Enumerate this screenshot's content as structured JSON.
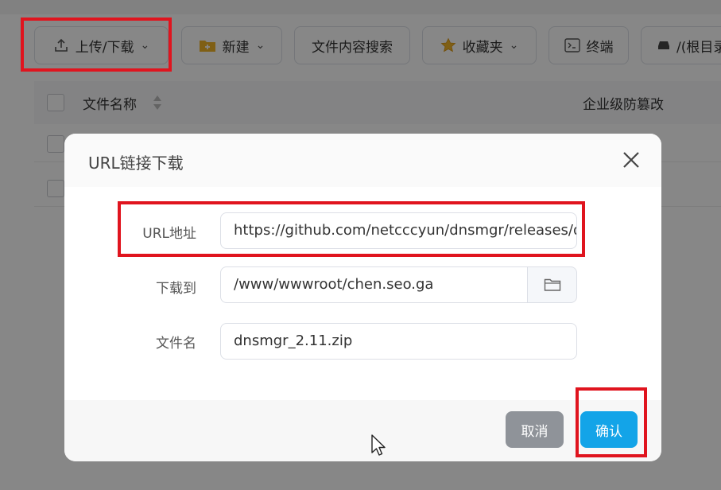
{
  "toolbar": {
    "upload_download": "上传/下载",
    "new": "新建",
    "content_search": "文件内容搜索",
    "favorites": "收藏夹",
    "terminal": "终端",
    "root_path": "/(根目录"
  },
  "table": {
    "col_name": "文件名称",
    "col_tamper": "企业级防篡改"
  },
  "dialog": {
    "title": "URL链接下载",
    "fields": {
      "url_label": "URL地址",
      "url_value": "https://github.com/netcccyun/dnsmgr/releases/download/",
      "download_to_label": "下载到",
      "download_to_value": "/www/wwwroot/chen.seo.ga",
      "filename_label": "文件名",
      "filename_value": "dnsmgr_2.11.zip"
    },
    "cancel": "取消",
    "confirm": "确认"
  },
  "colors": {
    "confirm_bg": "#13a4e8",
    "cancel_bg": "#8f9399",
    "highlight": "#e0141e"
  },
  "icons": [
    "upload-icon",
    "folder-plus-icon",
    "star-icon",
    "terminal-icon",
    "drive-icon",
    "sort-icon",
    "close-icon",
    "folder-icon",
    "cursor-icon"
  ]
}
